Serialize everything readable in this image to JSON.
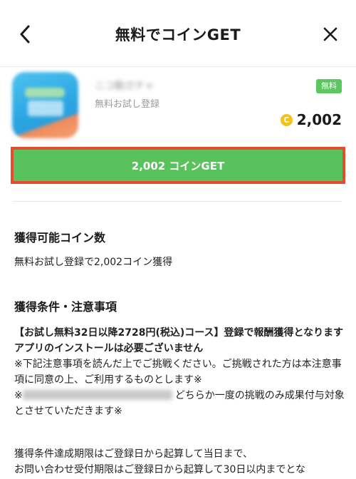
{
  "header": {
    "title": "無料でコインGET",
    "back_icon": "chevron-left-icon",
    "close_icon": "close-icon"
  },
  "offer": {
    "app_name": "ニコ動ガチャ",
    "subtitle": "無料お試し登録",
    "badge": "無料",
    "coin_symbol": "C",
    "coins": "2,002",
    "get_button_label": "2,002 コインGET",
    "accent_color": "#5ac25d",
    "highlight_color": "#e64a2f"
  },
  "sections": {
    "coins_title": "獲得可能コイン数",
    "coins_text": "無料お試し登録で2,002コイン獲得",
    "conditions_title": "獲得条件・注意事項",
    "cond_bold_1": "【お試し無料32日以降2728円(税込)コース】登録で報酬獲得となります",
    "cond_bold_2": "アプリのインストールは必要ございません",
    "cond_line_1": "※下記注意事項を読んだ上でご挑戦ください。ご挑戦された方は本注意事項に同意の上、ご利用するものとします※",
    "cond_line_2_tail": "どちらか一度の挑戦のみ成果付与対象とさせていただきます※",
    "cond_line_2_prefix": "※",
    "footer_1": "獲得条件達成期限はご登録日から起算して当日まで、",
    "footer_2": "お問い合わせ受付期限はご登録日から起算して30日以内までとな"
  }
}
